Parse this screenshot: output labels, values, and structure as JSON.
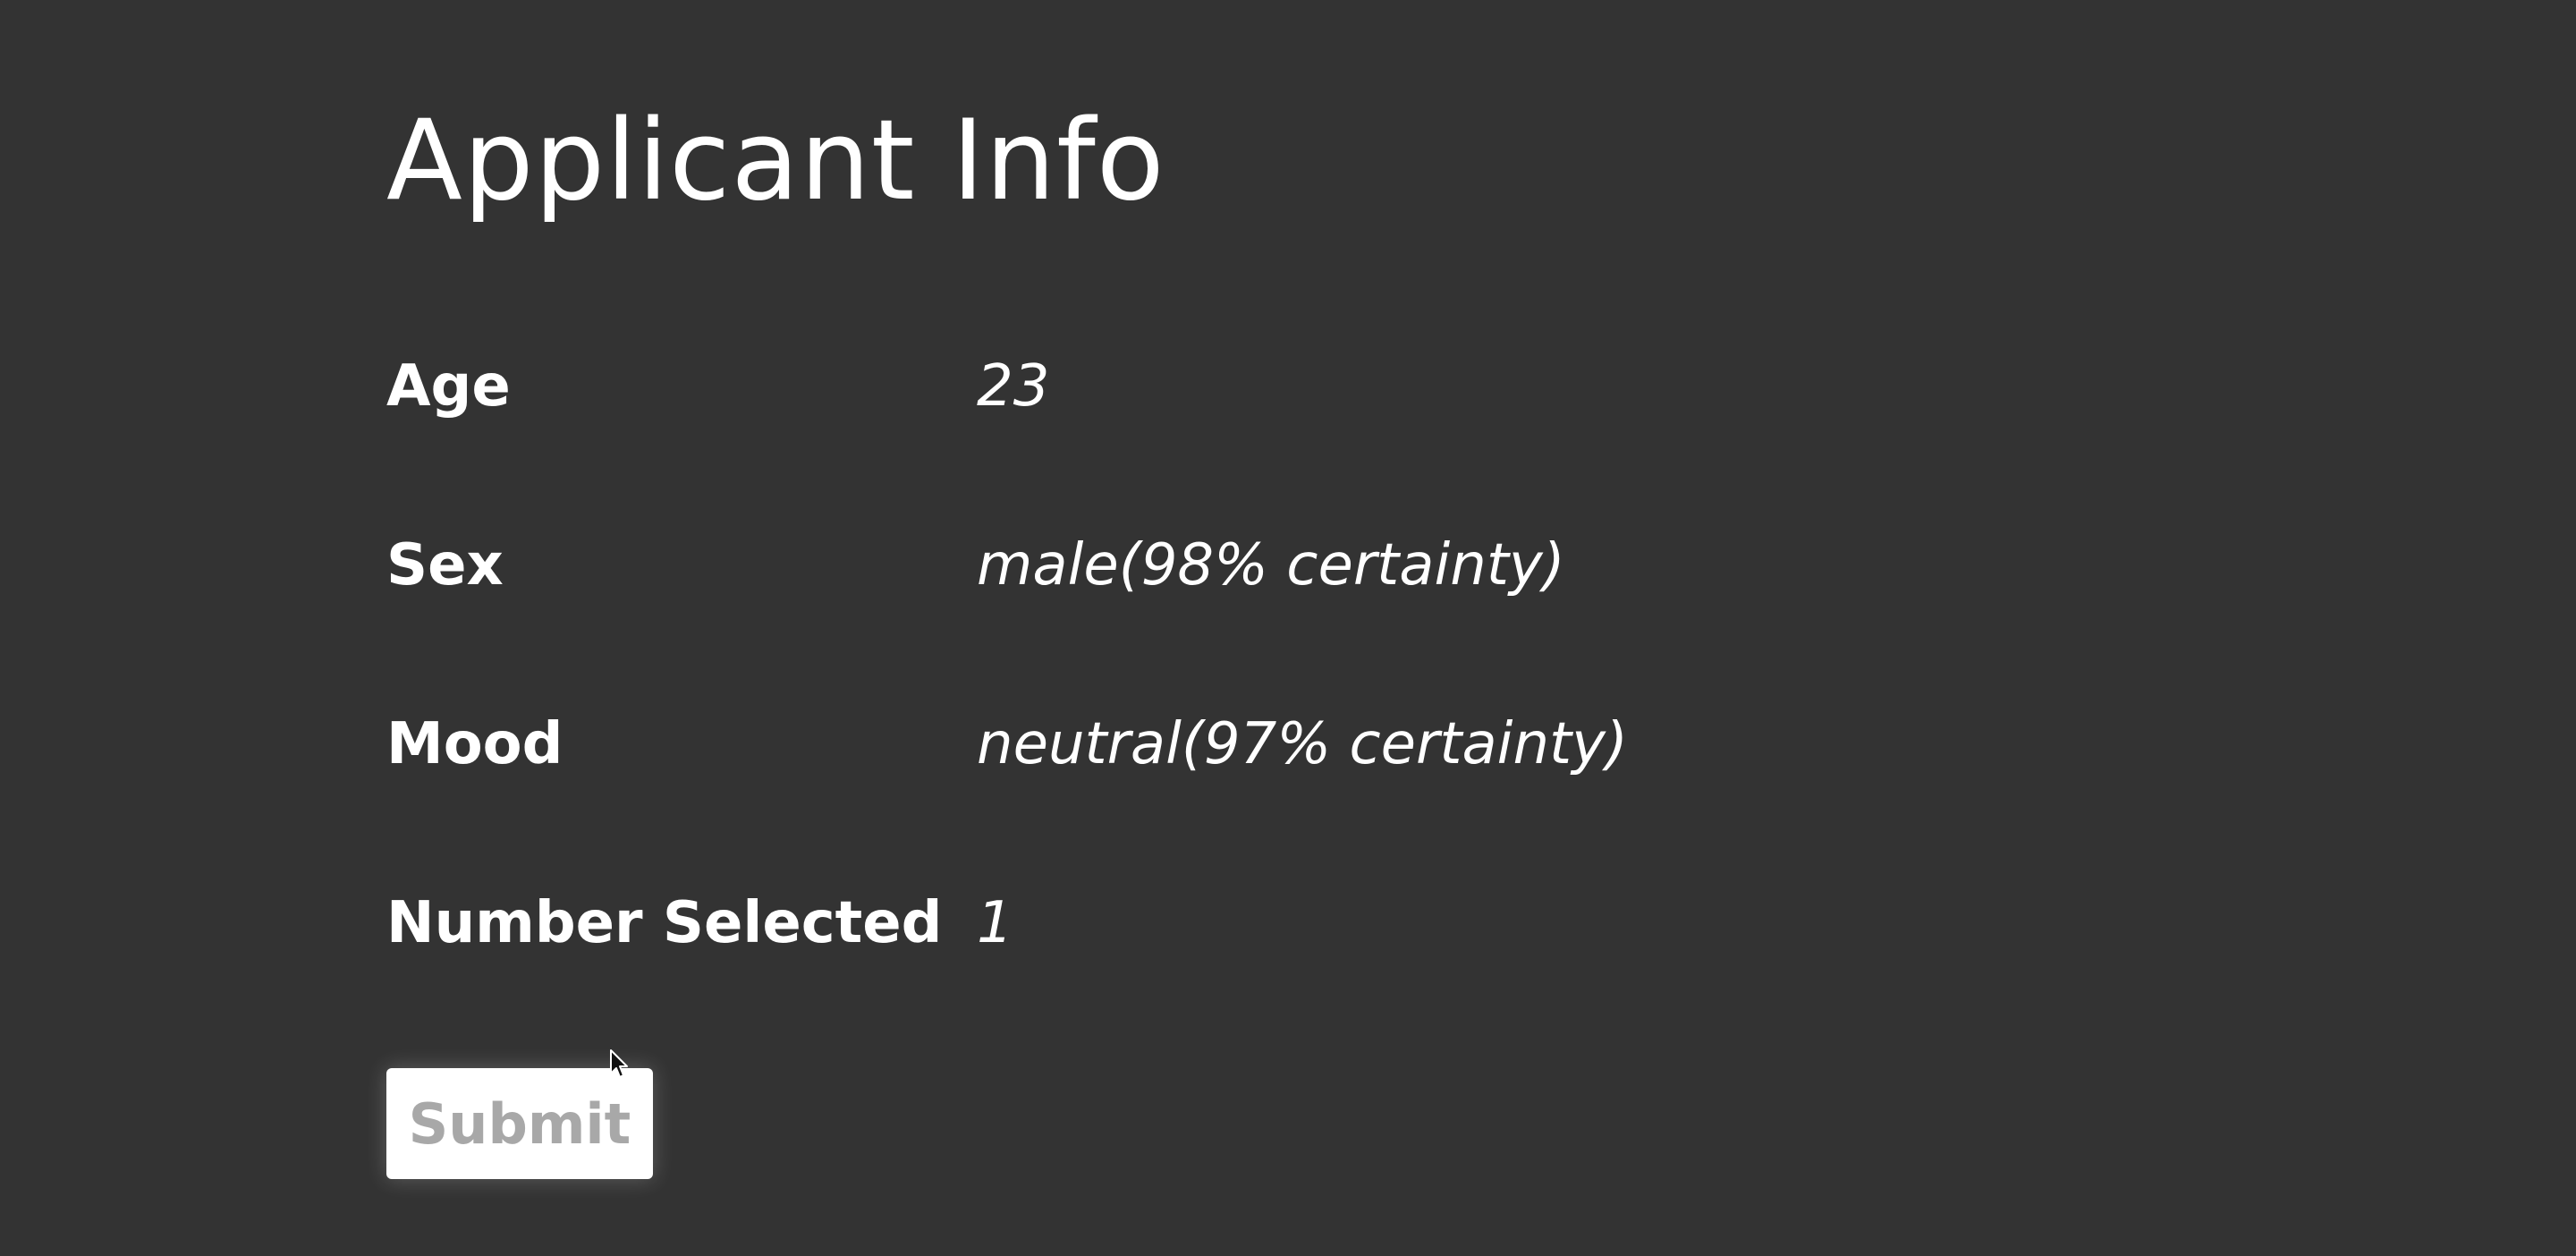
{
  "page": {
    "title": "Applicant Info"
  },
  "info": {
    "rows": [
      {
        "label": "Age",
        "value": "23"
      },
      {
        "label": "Sex",
        "value": "male(98% certainty)"
      },
      {
        "label": "Mood",
        "value": "neutral(97% certainty)"
      },
      {
        "label": "Number Selected",
        "value": "1"
      }
    ]
  },
  "actions": {
    "submit_label": "Submit"
  },
  "icons": {
    "cursor": "mouse-pointer-icon"
  },
  "colors": {
    "background": "#333333",
    "text": "#ffffff",
    "button_background": "#ffffff",
    "button_text": "#a8a8a8"
  }
}
